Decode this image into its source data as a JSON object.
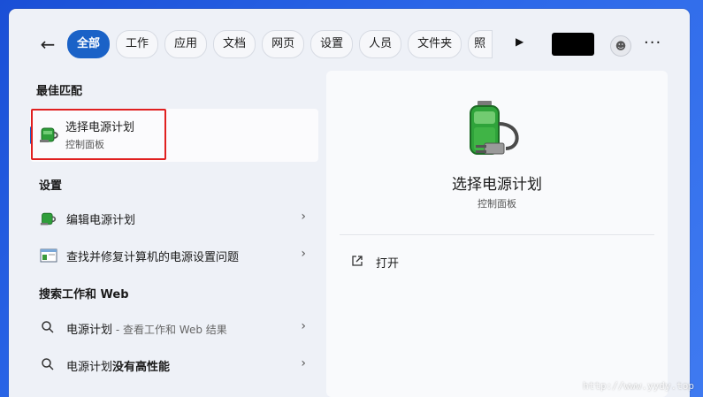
{
  "tabs": [
    "全部",
    "工作",
    "应用",
    "文档",
    "网页",
    "设置",
    "人员",
    "文件夹",
    "照"
  ],
  "best_match": {
    "heading": "最佳匹配",
    "title": "选择电源计划",
    "subtitle": "控制面板"
  },
  "settings": {
    "heading": "设置",
    "items": [
      "编辑电源计划",
      "查找并修复计算机的电源设置问题"
    ]
  },
  "web": {
    "heading": "搜索工作和 Web",
    "items": [
      {
        "main": "电源计划",
        "suffix": " - 查看工作和 Web 结果"
      },
      {
        "main": "电源计划",
        "bold": "没有高性能"
      }
    ]
  },
  "detail": {
    "title": "选择电源计划",
    "subtitle": "控制面板",
    "action_label": "打开"
  },
  "watermark": "http://www.yydy.top",
  "colors": {
    "accent": "#1a62c7",
    "highlight_box": "#e02020"
  }
}
